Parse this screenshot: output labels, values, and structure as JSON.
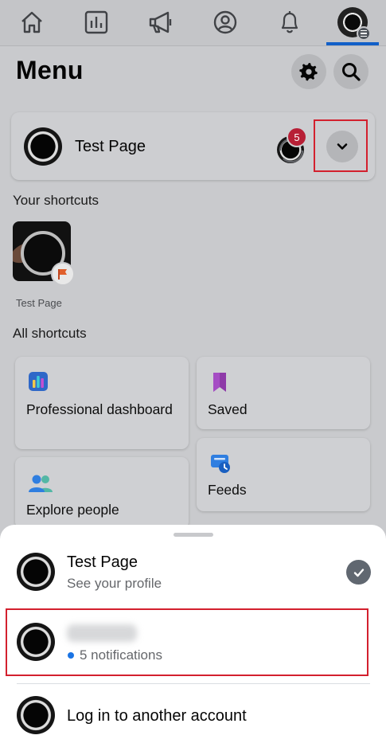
{
  "nav": {
    "items": [
      {
        "name": "home-icon"
      },
      {
        "name": "dashboard-icon"
      },
      {
        "name": "megaphone-icon"
      },
      {
        "name": "profile-icon"
      },
      {
        "name": "bell-icon"
      },
      {
        "name": "menu-avatar-icon",
        "active": true
      }
    ],
    "active_color": "#1260c8"
  },
  "header": {
    "title": "Menu",
    "settings_icon": "gear-icon",
    "search_icon": "search-icon"
  },
  "profile_card": {
    "name": "Test Page",
    "notification_count": "5",
    "badge_color": "#b71f36",
    "dropdown_icon": "chevron-down-icon"
  },
  "shortcuts": {
    "heading": "Your shortcuts",
    "items": [
      {
        "label": "Test Page"
      }
    ]
  },
  "all_shortcuts": {
    "heading": "All shortcuts",
    "tiles": [
      {
        "label": "Professional dashboard",
        "icon": "professional-dashboard-icon"
      },
      {
        "label": "Saved",
        "icon": "bookmark-icon"
      },
      {
        "label": "Explore people",
        "icon": "people-icon"
      },
      {
        "label": "Feeds",
        "icon": "feeds-icon"
      }
    ]
  },
  "account_sheet": {
    "accounts": [
      {
        "title": "Test Page",
        "subtitle": "See your profile",
        "selected": true
      },
      {
        "title": "",
        "subtitle": "5 notifications",
        "notification_dot_color": "#1b74e4"
      }
    ],
    "login_label": "Log in to another account"
  }
}
